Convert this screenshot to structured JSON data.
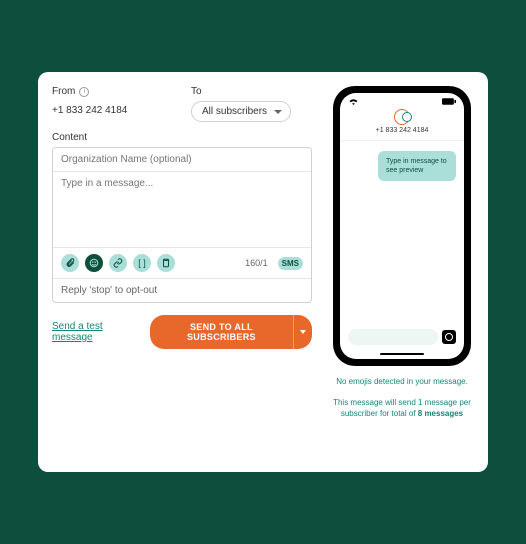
{
  "from": {
    "label": "From",
    "value": "+1 833 242 4184"
  },
  "to": {
    "label": "To",
    "selected": "All subscribers"
  },
  "content": {
    "label": "Content",
    "org_placeholder": "Organization Name (optional)",
    "msg_placeholder": "Type in a message...",
    "counter": "160/1",
    "sms_badge": "SMS",
    "optout": "Reply 'stop' to opt-out"
  },
  "actions": {
    "test_link": "Send a test message",
    "send_label": "SEND TO ALL SUBSCRIBERS"
  },
  "phone": {
    "contact": "+1 833 242 4184",
    "bubble": "Type in message to see preview"
  },
  "notes": {
    "emoji": "No emojis detected in your message.",
    "summary_prefix": "This message will send 1 message per subscriber for total of ",
    "summary_strong": "8 messages"
  }
}
